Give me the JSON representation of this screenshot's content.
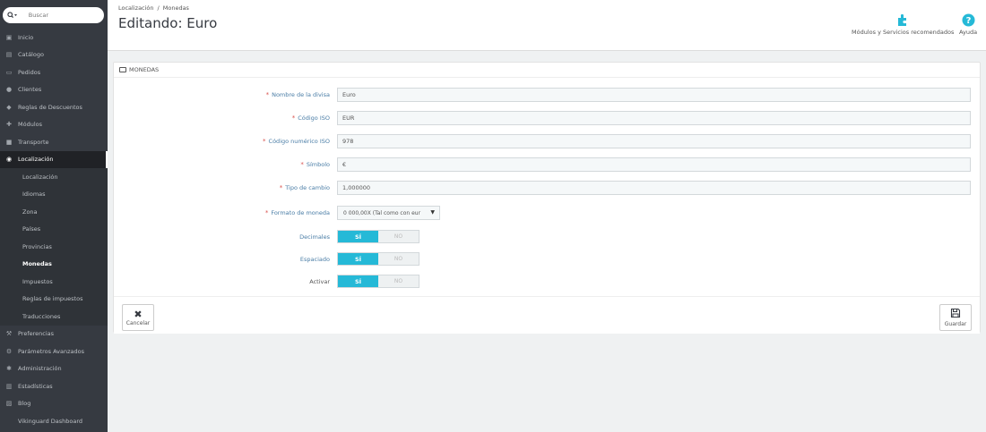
{
  "sidebar": {
    "search_placeholder": "Buscar",
    "items": [
      {
        "label": "Inicio",
        "icon": "dashboard-icon"
      },
      {
        "label": "Catálogo",
        "icon": "book-icon"
      },
      {
        "label": "Pedidos",
        "icon": "credit-card-icon"
      },
      {
        "label": "Clientes",
        "icon": "users-icon"
      },
      {
        "label": "Reglas de Descuentos",
        "icon": "tag-icon"
      },
      {
        "label": "Módulos",
        "icon": "puzzle-icon"
      },
      {
        "label": "Transporte",
        "icon": "truck-icon"
      },
      {
        "label": "Localización",
        "icon": "globe-icon"
      }
    ],
    "subitems": [
      {
        "label": "Localización"
      },
      {
        "label": "Idiomas"
      },
      {
        "label": "Zona"
      },
      {
        "label": "Países"
      },
      {
        "label": "Provincias"
      },
      {
        "label": "Monedas"
      },
      {
        "label": "Impuestos"
      },
      {
        "label": "Reglas de impuestos"
      },
      {
        "label": "Traducciones"
      }
    ],
    "items2": [
      {
        "label": "Preferencias",
        "icon": "wrench-icon"
      },
      {
        "label": "Parámetros Avanzados",
        "icon": "cogs-icon"
      },
      {
        "label": "Administración",
        "icon": "gear-icon"
      },
      {
        "label": "Estadísticas",
        "icon": "bar-chart-icon"
      },
      {
        "label": "Blog",
        "icon": "edit-icon"
      },
      {
        "label": "Vikinguard Dashboard",
        "icon": ""
      }
    ]
  },
  "header": {
    "breadcrumb": [
      "Localización",
      "/",
      "Monedas"
    ],
    "title": "Editando: Euro",
    "toolbar": {
      "modules_label": "Módulos y Servicios recomendados",
      "help_label": "Ayuda"
    }
  },
  "panel": {
    "title": "MONEDAS",
    "fields": {
      "name": {
        "label": "Nombre de la divisa",
        "value": "Euro"
      },
      "iso": {
        "label": "Código ISO",
        "value": "EUR"
      },
      "iso_num": {
        "label": "Código numérico ISO",
        "value": "978"
      },
      "symbol": {
        "label": "Símbolo",
        "value": "€"
      },
      "rate": {
        "label": "Tipo de cambio",
        "value": "1,000000"
      },
      "format": {
        "label": "Formato de moneda",
        "value": "0 000,00X (Tal como con eur"
      },
      "decimals": {
        "label": "Decimales"
      },
      "spacing": {
        "label": "Espaciado"
      },
      "active": {
        "label": "Activar"
      }
    },
    "switch_yes": "SÍ",
    "switch_no": "NO",
    "cancel_label": "Cancelar",
    "save_label": "Guardar"
  },
  "colors": {
    "sidebar_bg": "#363a41",
    "accent": "#25b9d7",
    "required": "#d9534f"
  }
}
